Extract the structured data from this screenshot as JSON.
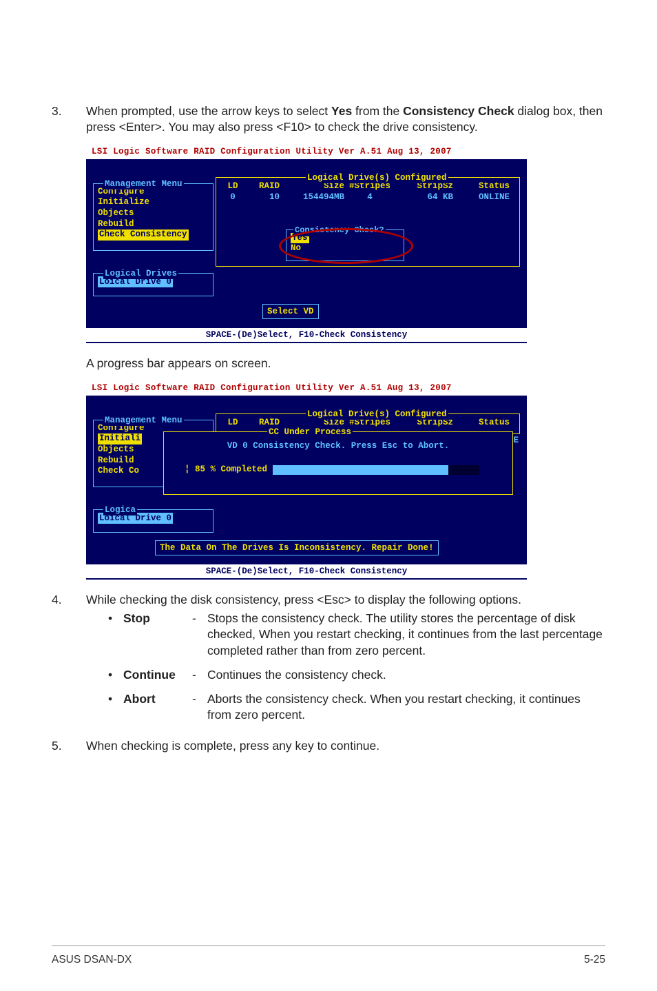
{
  "step3": {
    "num": "3.",
    "text_before_yes": "When prompted, use the arrow keys to select ",
    "yes": "Yes",
    "text_mid": " from the ",
    "cc_bold": "Consistency Check",
    "text_after": " dialog box, then press <Enter>. You may also press <F10> to check the drive consistency."
  },
  "terminal1": {
    "title": "LSI Logic Software RAID Configuration Utility Ver A.51 Aug 13, 2007",
    "mgmt_label": "Management Menu",
    "mgmt_items": [
      "Configure",
      "Initialize",
      "Objects",
      "Rebuild",
      "Check Consistency"
    ],
    "ld_label": "Logical Drives",
    "ld_item": "Loical Drive 0",
    "cfg_label": "Logical Drive(s) Configured",
    "headers": {
      "ld": "LD",
      "raid": "RAID",
      "size": "Size",
      "stripes": "#Stripes",
      "stripsz": "StripSz",
      "status": "Status"
    },
    "row": {
      "ld": "0",
      "raid": "10",
      "size": "154494MB",
      "stripes": "4",
      "stripsz": "64 KB",
      "status": "ONLINE"
    },
    "cc_label": "Consistency Check?",
    "cc_yes": "Yes",
    "cc_no": "No",
    "select_btn": "Select VD",
    "status_bar": "SPACE-(De)Select, F10-Check Consistency"
  },
  "caption1": "A progress bar appears on screen.",
  "terminal2": {
    "title": "LSI Logic Software RAID Configuration Utility Ver A.51 Aug 13, 2007",
    "mgmt_label": "Management Menu",
    "mgmt_items2": [
      "Configure",
      "Initiali",
      "Objects",
      "Rebuild",
      "Check Co"
    ],
    "ld_label2": "Logica",
    "ld_item": "Loical Drive 0",
    "cfg_label": "Logical Drive(s) Configured",
    "headers": {
      "ld": "LD",
      "raid": "RAID",
      "size": "Size",
      "stripes": "#Stripes",
      "stripsz": "StripSz",
      "status": "Status"
    },
    "partial_status": "ONLINE",
    "under_label": "CC Under Process",
    "under_text": "VD 0 Consistency Check. Press Esc to Abort.",
    "progress_pct": 85,
    "progress_label": "¦ 85 % Completed",
    "repair_done": "The Data On The Drives Is Inconsistency. Repair Done!",
    "status_bar": "SPACE-(De)Select, F10-Check Consistency"
  },
  "step4": {
    "num": "4.",
    "text": "While checking the disk consistency, press <Esc> to display the following options.",
    "items": [
      {
        "term": "Stop",
        "dash": "-",
        "desc": "Stops the consistency check. The utility stores the percentage of disk checked, When you restart checking, it continues from the last percentage completed rather than from zero percent."
      },
      {
        "term": "Continue",
        "dash": "-",
        "desc": "Continues the consistency check."
      },
      {
        "term": "Abort",
        "dash": "-",
        "desc": "Aborts the consistency check. When you restart checking, it continues from zero percent."
      }
    ]
  },
  "step5": {
    "num": "5.",
    "text": "When checking is complete, press any key to continue."
  },
  "footer": {
    "left": "ASUS DSAN-DX",
    "right": "5-25"
  },
  "chart_data": {
    "type": "table",
    "title": "Logical Drive(s) Configured",
    "columns": [
      "LD",
      "RAID",
      "Size",
      "#Stripes",
      "StripSz",
      "Status"
    ],
    "rows": [
      [
        "0",
        "10",
        "154494MB",
        "4",
        "64 KB",
        "ONLINE"
      ]
    ],
    "progress": {
      "label": "CC Under Process – VD 0 Consistency Check",
      "percent_completed": 85
    }
  }
}
